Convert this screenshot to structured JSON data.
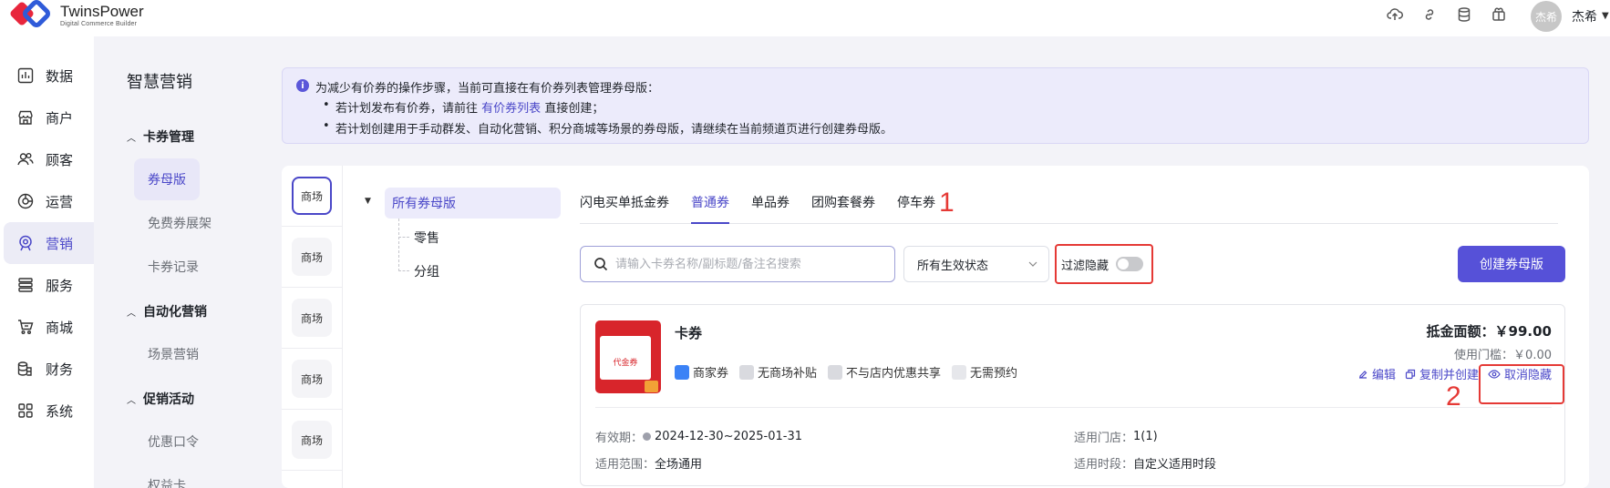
{
  "header": {
    "brand_name": "TwinsPower",
    "brand_sub": "Digital Commerce Builder",
    "avatar_text": "杰希",
    "username": "杰希",
    "icons": [
      "cloud-upload-icon",
      "link-icon",
      "database-icon",
      "gift-icon"
    ]
  },
  "nav_primary": [
    {
      "label": "数据",
      "icon": "chart-icon"
    },
    {
      "label": "商户",
      "icon": "store-icon"
    },
    {
      "label": "顾客",
      "icon": "users-icon"
    },
    {
      "label": "运营",
      "icon": "compass-icon"
    },
    {
      "label": "营销",
      "icon": "marketing-icon",
      "active": true
    },
    {
      "label": "服务",
      "icon": "list-icon"
    },
    {
      "label": "商城",
      "icon": "cart-icon"
    },
    {
      "label": "财务",
      "icon": "coins-icon"
    },
    {
      "label": "系统",
      "icon": "grid-icon"
    }
  ],
  "nav_secondary": {
    "title": "智慧营销",
    "groups": [
      {
        "label": "卡券管理",
        "items": [
          "券母版",
          "免费券展架",
          "卡券记录"
        ]
      },
      {
        "label": "自动化营销",
        "items": [
          "场景营销"
        ]
      },
      {
        "label": "促销活动",
        "items": [
          "优惠口令",
          "权益卡"
        ]
      }
    ]
  },
  "banner": {
    "line1": "为减少有价券的操作步骤，当前可直接在有价券列表管理券母版：",
    "line2_prefix": "若计划发布有价券，请前往",
    "line2_link": "有价券列表",
    "line2_suffix": "直接创建；",
    "line3": "若计划创建用于手动群发、自动化营销、积分商城等场景的券母版，请继续在当前频道页进行创建券母版。"
  },
  "locations": [
    "商场",
    "商场",
    "商场",
    "商场",
    "商场"
  ],
  "tree": {
    "root": "所有券母版",
    "children": [
      "零售",
      "分组"
    ]
  },
  "tabs": [
    "闪电买单抵金券",
    "普通券",
    "单品券",
    "团购套餐券",
    "停车券"
  ],
  "toolbar": {
    "search_placeholder": "请输入卡券名称/副标题/备注名搜索",
    "status_select": "所有生效状态",
    "filter_label": "过滤隐藏",
    "create_label": "创建券母版"
  },
  "annotations": [
    "1",
    "2"
  ],
  "coupon": {
    "thumb_text": "代金券",
    "title": "卡券",
    "tags": [
      "商家券",
      "无商场补贴",
      "不与店内优惠共享",
      "无需预约"
    ],
    "amount": "抵金面额：￥99.00",
    "threshold": "使用门槛：￥0.00",
    "actions": {
      "edit": "编辑",
      "copy": "复制并创建",
      "unhide": "取消隐藏"
    },
    "validity_label": "有效期：",
    "validity": "2024-12-30~2025-01-31",
    "scope_label": "适用范围：",
    "scope": "全场通用",
    "stores_label": "适用门店：",
    "stores": "1(1)",
    "time_label": "适用时段：",
    "time": "自定义适用时段"
  },
  "colors": {
    "accent": "#5651d8",
    "highlight": "#e53935"
  }
}
